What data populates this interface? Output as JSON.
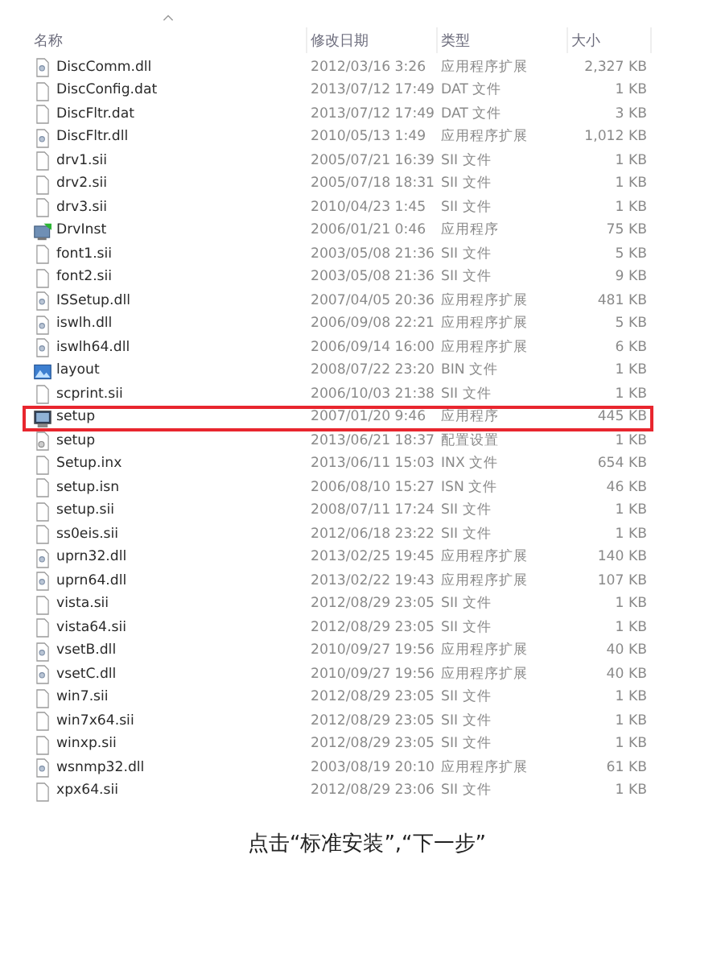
{
  "columns": [
    "名称",
    "修改日期",
    "类型",
    "大小"
  ],
  "files": [
    {
      "name": "DiscComm.dll",
      "date": "2012/03/16 3:26",
      "type": "应用程序扩展",
      "size": "2,327 KB",
      "kind": "dll",
      "highlighted": false
    },
    {
      "name": "DiscConfig.dat",
      "date": "2013/07/12 17:49",
      "type": "DAT 文件",
      "size": "1 KB",
      "kind": "file",
      "highlighted": false
    },
    {
      "name": "DiscFltr.dat",
      "date": "2013/07/12 17:49",
      "type": "DAT 文件",
      "size": "3 KB",
      "kind": "file",
      "highlighted": false
    },
    {
      "name": "DiscFltr.dll",
      "date": "2010/05/13 1:49",
      "type": "应用程序扩展",
      "size": "1,012 KB",
      "kind": "dll",
      "highlighted": false
    },
    {
      "name": "drv1.sii",
      "date": "2005/07/21 16:39",
      "type": "SII 文件",
      "size": "1 KB",
      "kind": "file",
      "highlighted": false
    },
    {
      "name": "drv2.sii",
      "date": "2005/07/18 18:31",
      "type": "SII 文件",
      "size": "1 KB",
      "kind": "file",
      "highlighted": false
    },
    {
      "name": "drv3.sii",
      "date": "2010/04/23 1:45",
      "type": "SII 文件",
      "size": "1 KB",
      "kind": "file",
      "highlighted": false
    },
    {
      "name": "DrvInst",
      "date": "2006/01/21 0:46",
      "type": "应用程序",
      "size": "75 KB",
      "kind": "app",
      "highlighted": false
    },
    {
      "name": "font1.sii",
      "date": "2003/05/08 21:36",
      "type": "SII 文件",
      "size": "5 KB",
      "kind": "file",
      "highlighted": false
    },
    {
      "name": "font2.sii",
      "date": "2003/05/08 21:36",
      "type": "SII 文件",
      "size": "9 KB",
      "kind": "file",
      "highlighted": false
    },
    {
      "name": "ISSetup.dll",
      "date": "2007/04/05 20:36",
      "type": "应用程序扩展",
      "size": "481 KB",
      "kind": "dll",
      "highlighted": false
    },
    {
      "name": "iswlh.dll",
      "date": "2006/09/08 22:21",
      "type": "应用程序扩展",
      "size": "5 KB",
      "kind": "dll",
      "highlighted": false
    },
    {
      "name": "iswlh64.dll",
      "date": "2006/09/14 16:00",
      "type": "应用程序扩展",
      "size": "6 KB",
      "kind": "dll",
      "highlighted": false
    },
    {
      "name": "layout",
      "date": "2008/07/22 23:20",
      "type": "BIN 文件",
      "size": "1 KB",
      "kind": "bin",
      "highlighted": false
    },
    {
      "name": "scprint.sii",
      "date": "2006/10/03 21:38",
      "type": "SII 文件",
      "size": "1 KB",
      "kind": "file",
      "highlighted": false
    },
    {
      "name": "setup",
      "date": "2007/01/20 9:46",
      "type": "应用程序",
      "size": "445 KB",
      "kind": "setup",
      "highlighted": true
    },
    {
      "name": "setup",
      "date": "2013/06/21 18:37",
      "type": "配置设置",
      "size": "1 KB",
      "kind": "config",
      "highlighted": false
    },
    {
      "name": "Setup.inx",
      "date": "2013/06/11 15:03",
      "type": "INX 文件",
      "size": "654 KB",
      "kind": "file",
      "highlighted": false
    },
    {
      "name": "setup.isn",
      "date": "2006/08/10 15:27",
      "type": "ISN 文件",
      "size": "46 KB",
      "kind": "file",
      "highlighted": false
    },
    {
      "name": "setup.sii",
      "date": "2008/07/11 17:24",
      "type": "SII 文件",
      "size": "1 KB",
      "kind": "file",
      "highlighted": false
    },
    {
      "name": "ss0eis.sii",
      "date": "2012/06/18 23:22",
      "type": "SII 文件",
      "size": "1 KB",
      "kind": "file",
      "highlighted": false
    },
    {
      "name": "uprn32.dll",
      "date": "2013/02/25 19:45",
      "type": "应用程序扩展",
      "size": "140 KB",
      "kind": "dll",
      "highlighted": false
    },
    {
      "name": "uprn64.dll",
      "date": "2013/02/22 19:43",
      "type": "应用程序扩展",
      "size": "107 KB",
      "kind": "dll",
      "highlighted": false
    },
    {
      "name": "vista.sii",
      "date": "2012/08/29 23:05",
      "type": "SII 文件",
      "size": "1 KB",
      "kind": "file",
      "highlighted": false
    },
    {
      "name": "vista64.sii",
      "date": "2012/08/29 23:05",
      "type": "SII 文件",
      "size": "1 KB",
      "kind": "file",
      "highlighted": false
    },
    {
      "name": "vsetB.dll",
      "date": "2010/09/27 19:56",
      "type": "应用程序扩展",
      "size": "40 KB",
      "kind": "dll",
      "highlighted": false
    },
    {
      "name": "vsetC.dll",
      "date": "2010/09/27 19:56",
      "type": "应用程序扩展",
      "size": "40 KB",
      "kind": "dll",
      "highlighted": false
    },
    {
      "name": "win7.sii",
      "date": "2012/08/29 23:05",
      "type": "SII 文件",
      "size": "1 KB",
      "kind": "file",
      "highlighted": false
    },
    {
      "name": "win7x64.sii",
      "date": "2012/08/29 23:05",
      "type": "SII 文件",
      "size": "1 KB",
      "kind": "file",
      "highlighted": false
    },
    {
      "name": "winxp.sii",
      "date": "2012/08/29 23:05",
      "type": "SII 文件",
      "size": "1 KB",
      "kind": "file",
      "highlighted": false
    },
    {
      "name": "wsnmp32.dll",
      "date": "2003/08/19 20:10",
      "type": "应用程序扩展",
      "size": "61 KB",
      "kind": "dll",
      "highlighted": false
    },
    {
      "name": "xpx64.sii",
      "date": "2012/08/29 23:06",
      "type": "SII 文件",
      "size": "1 KB",
      "kind": "file",
      "highlighted": false
    }
  ],
  "caption": "点击“标准安装”,“下一步”"
}
